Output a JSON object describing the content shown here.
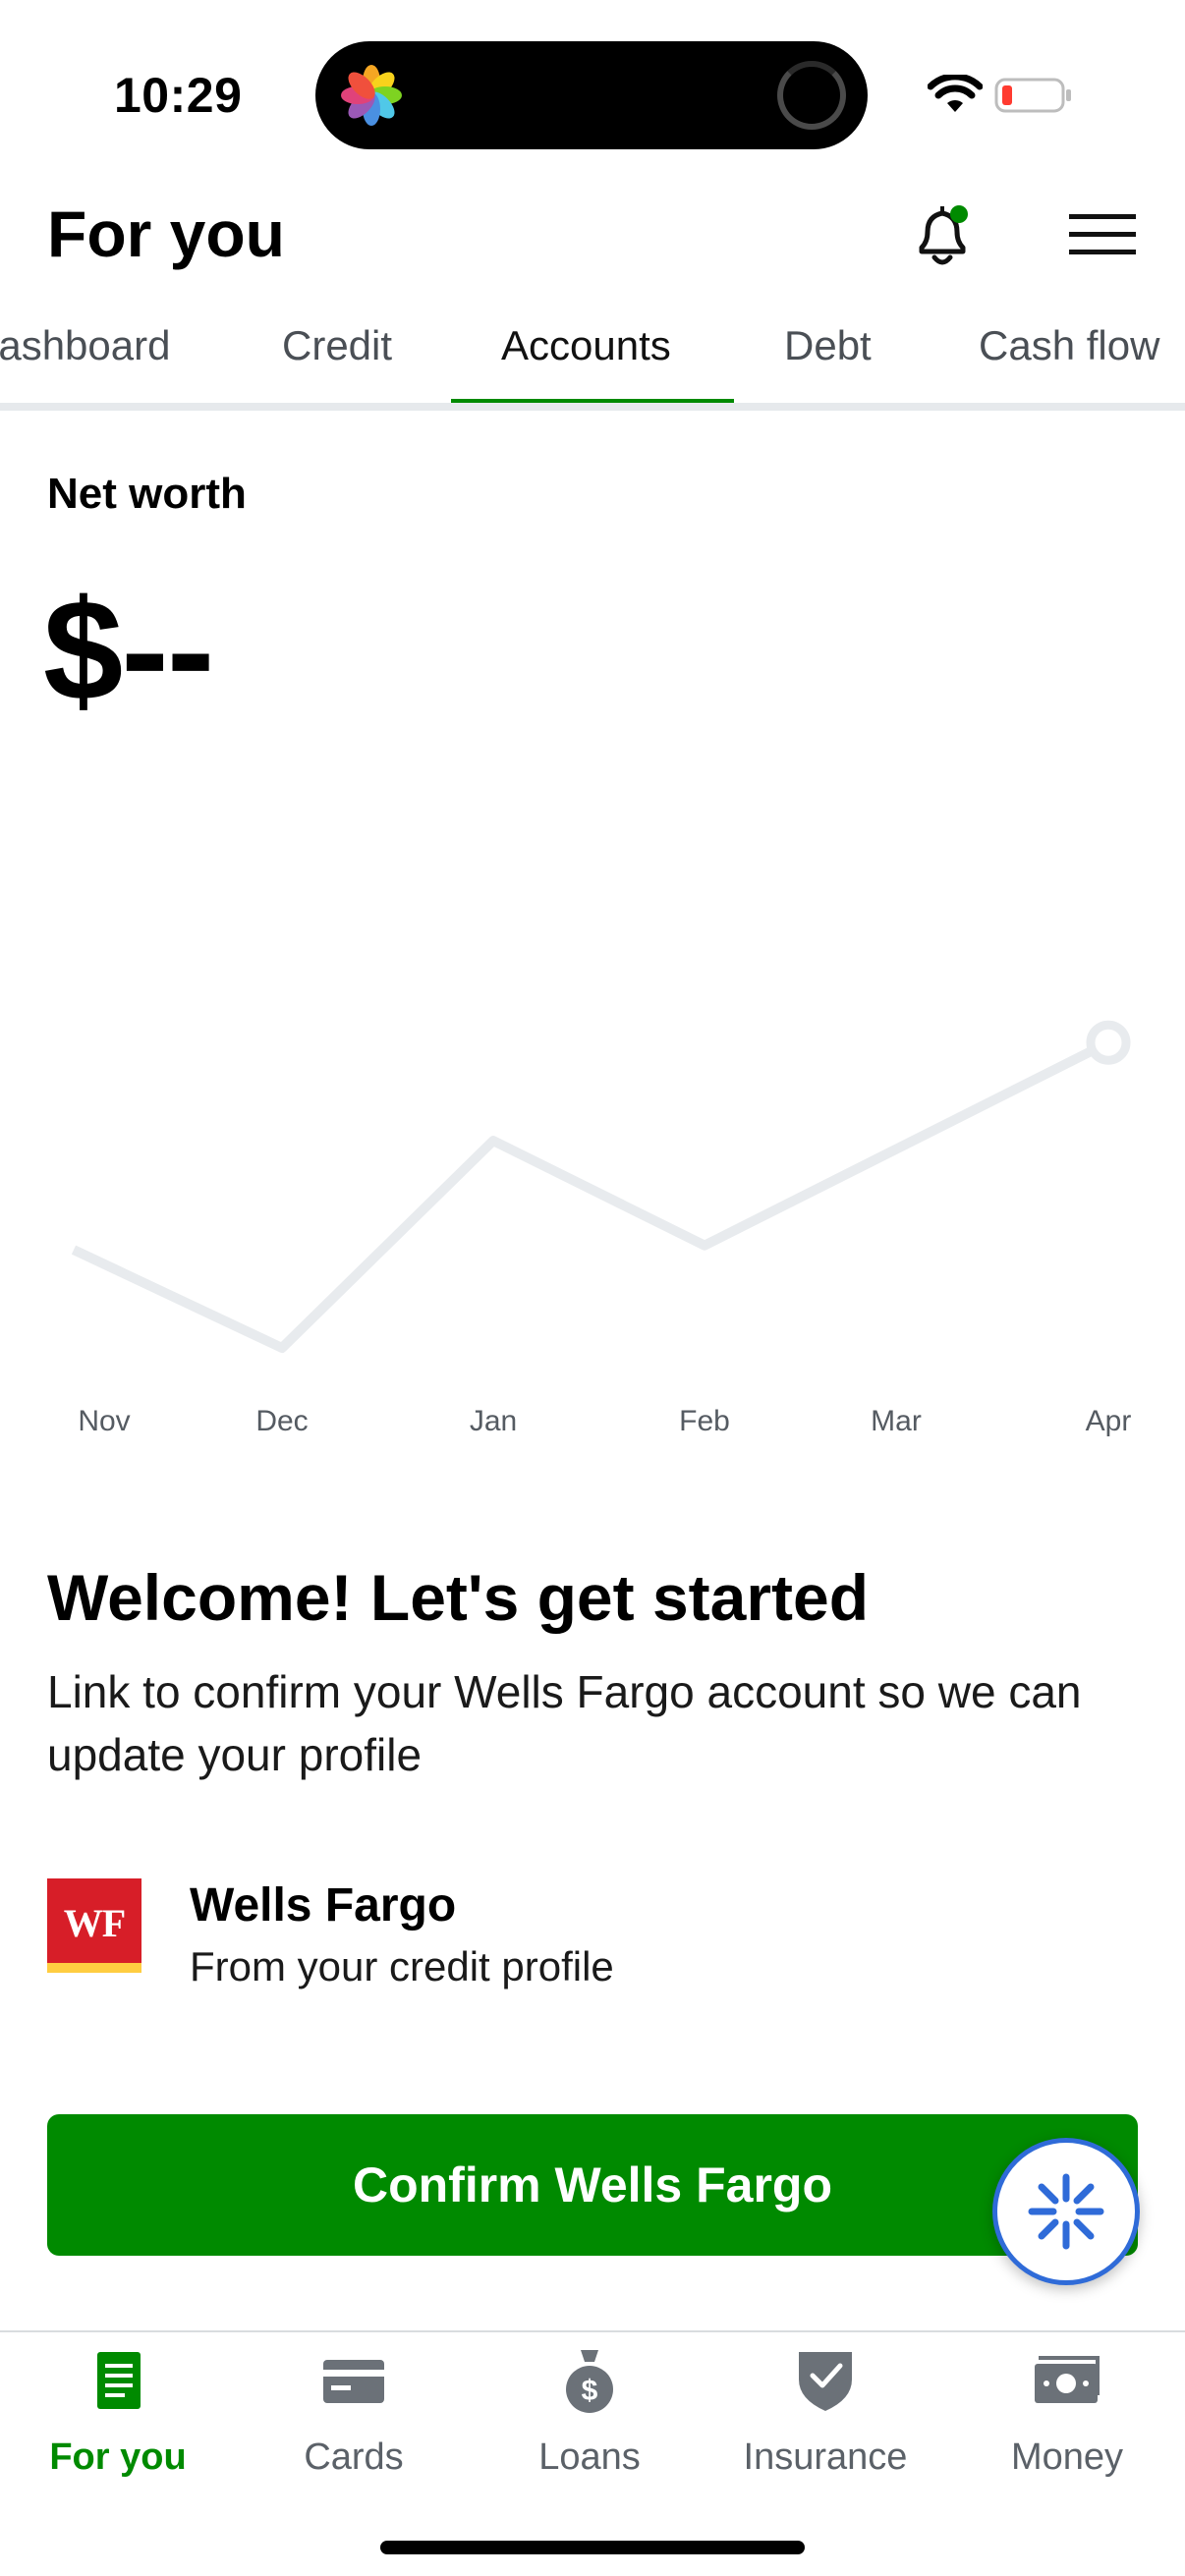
{
  "status_bar": {
    "time": "10:29"
  },
  "header": {
    "title": "For you"
  },
  "tabs": [
    {
      "label": "Dashboard",
      "active": false
    },
    {
      "label": "Credit",
      "active": false
    },
    {
      "label": "Accounts",
      "active": true
    },
    {
      "label": "Debt",
      "active": false
    },
    {
      "label": "Cash flow",
      "active": false
    }
  ],
  "net_worth": {
    "label": "Net worth",
    "value": "$--"
  },
  "chart_data": {
    "type": "line",
    "categories": [
      "Nov",
      "Dec",
      "Jan",
      "Feb",
      "Mar",
      "Apr"
    ],
    "series": [
      {
        "values": [
          0.45,
          0.0,
          0.95,
          0.47,
          null,
          1.4
        ]
      }
    ],
    "note_values_unlabeled": true,
    "grid": false,
    "line_color": "#e8ebee"
  },
  "welcome": {
    "title": "Welcome! Let's get started",
    "text": "Link to confirm your Wells Fargo account so we can update your profile"
  },
  "bank": {
    "logo_text": "WF",
    "name": "Wells Fargo",
    "subtitle": "From your credit profile"
  },
  "confirm_button": {
    "label": "Confirm Wells Fargo"
  },
  "bottom_nav": [
    {
      "label": "For you",
      "icon": "document-icon",
      "active": true
    },
    {
      "label": "Cards",
      "icon": "card-icon",
      "active": false
    },
    {
      "label": "Loans",
      "icon": "money-bag-icon",
      "active": false
    },
    {
      "label": "Insurance",
      "icon": "shield-icon",
      "active": false
    },
    {
      "label": "Money",
      "icon": "cash-icon",
      "active": false
    }
  ],
  "colors": {
    "brand_green": "#008a00",
    "fab_blue": "#2f6bd8",
    "wf_red": "#d71e28",
    "wf_gold": "#ffcd41"
  }
}
